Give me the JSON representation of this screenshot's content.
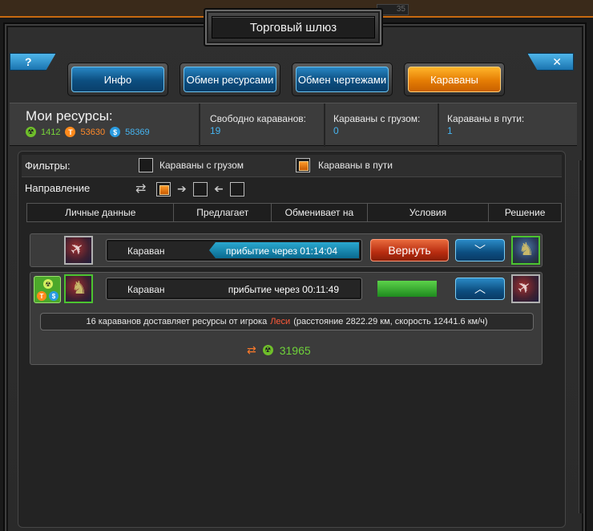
{
  "background": {
    "counter": "35"
  },
  "window": {
    "title": "Торговый шлюз",
    "help_label": "?",
    "close_label": "✕"
  },
  "tabs": [
    {
      "label": "Инфо",
      "active": false
    },
    {
      "label": "Обмен ресурсами",
      "active": false
    },
    {
      "label": "Обмен чертежами",
      "active": false
    },
    {
      "label": "Караваны",
      "active": true
    }
  ],
  "resources": {
    "title": "Мои ресурсы:",
    "radiation": "1412",
    "titanium": "53630",
    "cash": "58369",
    "titanium_symbol": "T",
    "cash_symbol": "$",
    "radiation_symbol": "☢"
  },
  "stats": [
    {
      "label": "Свободно караванов:",
      "value": "19"
    },
    {
      "label": "Караваны с грузом:",
      "value": "0"
    },
    {
      "label": "Караваны в пути:",
      "value": "1"
    }
  ],
  "filters": {
    "label": "Фильтры:",
    "with_cargo": {
      "label": "Караваны с грузом",
      "checked": false
    },
    "in_transit": {
      "label": "Караваны в пути",
      "checked": true
    }
  },
  "direction": {
    "label": "Направление",
    "both_checked": true,
    "outgoing_checked": false,
    "incoming_checked": false
  },
  "columns": [
    "Личные данные",
    "Предлагает",
    "Обменивает на",
    "Условия",
    "Решение"
  ],
  "caravans": [
    {
      "name": "Караван",
      "status": "прибытие через 01:14:04",
      "action_label": "Вернуть",
      "toggle": "expand"
    },
    {
      "name": "Караван",
      "status": "прибытие через 00:11:49",
      "toggle": "collapse",
      "info_prefix": "16 караванов доставляет ресурсы от игрока",
      "player": "Леси",
      "info_suffix": "(расстояние 2822.29 км, скорость 12441.6 км/ч)",
      "cargo_amount": "31965"
    }
  ],
  "colors": {
    "accent_blue": "#1a74b0",
    "accent_orange": "#e57d04",
    "return_red": "#b82c10",
    "resource_green": "#78d43a"
  }
}
